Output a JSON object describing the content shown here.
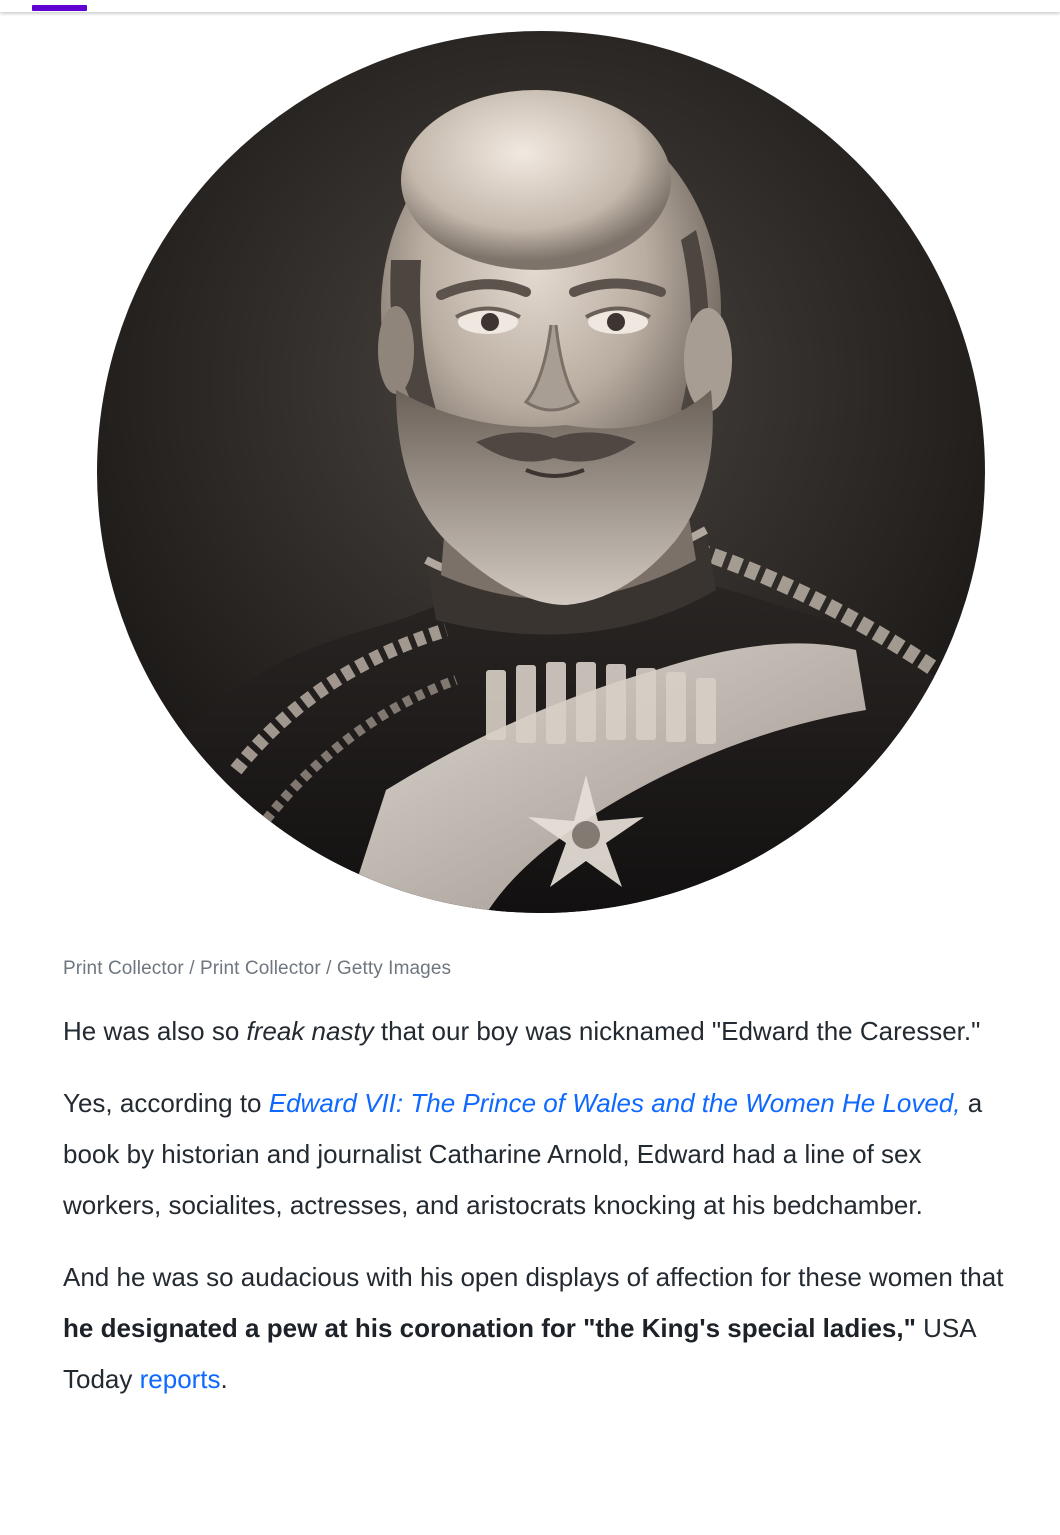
{
  "brand": {
    "accent_color": "#6001d2",
    "link_color": "#0f69ff"
  },
  "image": {
    "subject": "Sepia portrait photograph of Edward VII in military uniform",
    "icon": "portrait-photo"
  },
  "caption": "Print Collector / Print Collector / Getty Images",
  "paragraphs": {
    "p1": {
      "before": "He was also so ",
      "emphasis": "freak nasty",
      "after": " that our boy was nicknamed \"Edward the Caresser.\""
    },
    "p2": {
      "before": "Yes, according to ",
      "link": "Edward VII: The Prince of Wales and the Women He Loved,",
      "after": " a book by historian and journalist Catharine Arnold, Edward had a line of sex workers, socialites, actresses, and aristocrats knocking at his bedchamber."
    },
    "p3": {
      "before": "And he was so audacious with his open displays of affection for these women that ",
      "bold": "he designated a pew at his coronation for \"the King's special ladies,\"",
      "middle": " USA Today ",
      "link": "reports",
      "after": "."
    }
  }
}
